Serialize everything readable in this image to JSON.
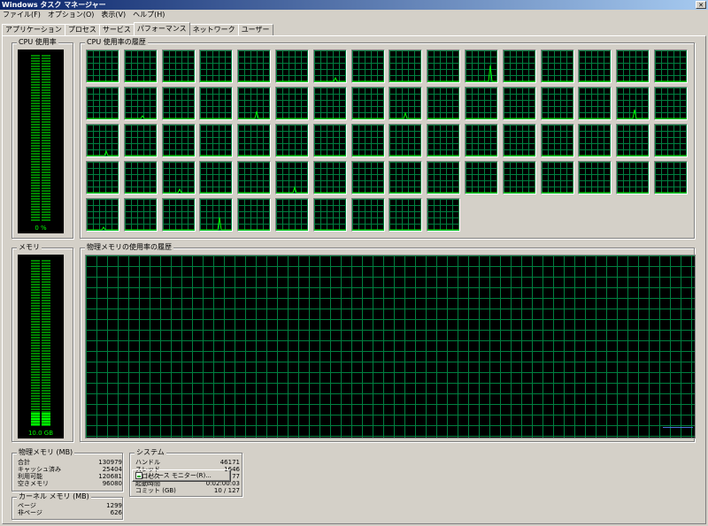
{
  "window": {
    "title": "Windows タスク マネージャー",
    "close_glyph": "✕"
  },
  "menu": [
    "ファイル(F)",
    "オプション(O)",
    "表示(V)",
    "ヘルプ(H)"
  ],
  "tabs": [
    {
      "label": "アプリケーション",
      "active": false
    },
    {
      "label": "プロセス",
      "active": false
    },
    {
      "label": "サービス",
      "active": false
    },
    {
      "label": "パフォーマンス",
      "active": true
    },
    {
      "label": "ネットワーク",
      "active": false
    },
    {
      "label": "ユーザー",
      "active": false
    }
  ],
  "cpu_usage": {
    "title": "CPU 使用率",
    "value_label": "0 %",
    "percent": 0
  },
  "cpu_history": {
    "title": "CPU 使用率の履歴",
    "core_count": 74,
    "columns": 16
  },
  "memory": {
    "title": "メモリ",
    "value_label": "10.0 GB",
    "fraction": 0.08
  },
  "memory_history": {
    "title": "物理メモリの使用率の履歴"
  },
  "physical_memory": {
    "title": "物理メモリ (MB)",
    "rows": [
      {
        "label": "合計",
        "value": "130979"
      },
      {
        "label": "キャッシュ済み",
        "value": "25404"
      },
      {
        "label": "利用可能",
        "value": "120681"
      },
      {
        "label": "空きメモリ",
        "value": "96080"
      }
    ]
  },
  "kernel_memory": {
    "title": "カーネル メモリ (MB)",
    "rows": [
      {
        "label": "ページ",
        "value": "1299"
      },
      {
        "label": "非ページ",
        "value": "626"
      }
    ]
  },
  "system": {
    "title": "システム",
    "rows": [
      {
        "label": "ハンドル",
        "value": "46171"
      },
      {
        "label": "スレッド",
        "value": "1646"
      },
      {
        "label": "プロセス",
        "value": "77"
      },
      {
        "label": "起動時間",
        "value": "0:02:00:03"
      },
      {
        "label": "コミット (GB)",
        "value": "10 / 127"
      }
    ]
  },
  "resource_monitor_button": "リソース モニター(R)...",
  "colors": {
    "grid": "#008040",
    "trace": "#00ff00",
    "memory_trace": "#4a6fd8",
    "background": "#d4d0c8"
  }
}
